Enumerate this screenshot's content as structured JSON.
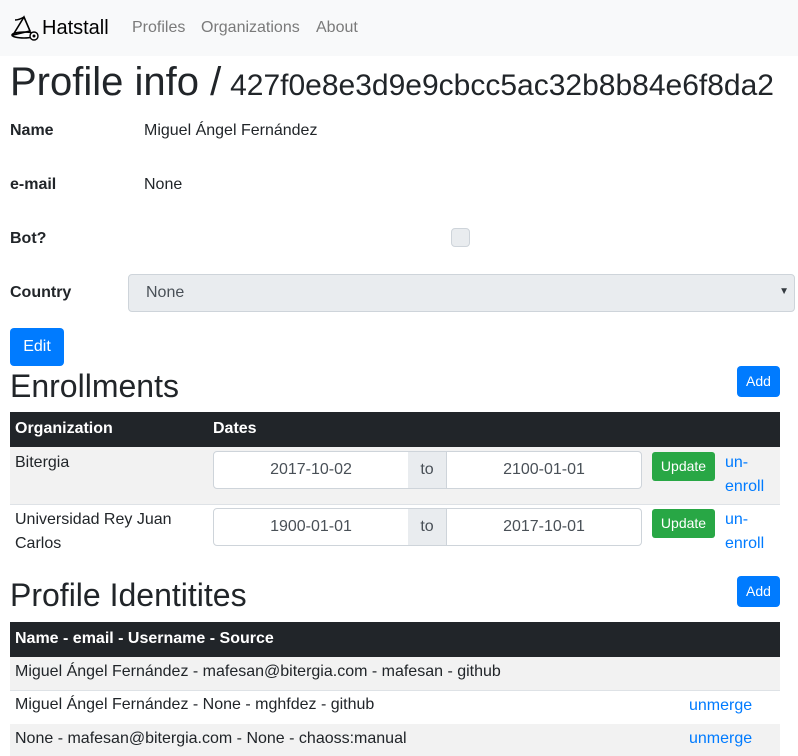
{
  "navbar": {
    "brand": "Hatstall",
    "links": [
      "Profiles",
      "Organizations",
      "About"
    ]
  },
  "page": {
    "title_prefix": "Profile info /",
    "profile_id": "427f0e8e3d9e9cbcc5ac32b8b84e6f8da2"
  },
  "profile": {
    "name_label": "Name",
    "name_value": "Miguel Ángel Fernández",
    "email_label": "e-mail",
    "email_value": "None",
    "bot_label": "Bot?",
    "country_label": "Country",
    "country_value": "None",
    "edit_label": "Edit"
  },
  "enrollments": {
    "title": "Enrollments",
    "add_label": "Add",
    "headers": [
      "Organization",
      "Dates"
    ],
    "to_label": "to",
    "update_label": "Update",
    "unenroll_label_1": "un-",
    "unenroll_label_2": "enroll",
    "rows": [
      {
        "org_line1": "Bitergia",
        "org_line2": "",
        "from": "2017-10-02",
        "to": "2100-01-01"
      },
      {
        "org_line1": "Universidad Rey Juan",
        "org_line2": "Carlos",
        "from": "1900-01-01",
        "to": "2017-10-01"
      }
    ]
  },
  "identities": {
    "title": "Profile Identitites",
    "add_label": "Add",
    "header": "Name - email - Username - Source",
    "unmerge_label": "unmerge",
    "rows": [
      {
        "text": "Miguel Ángel Fernández - mafesan@bitergia.com - mafesan - github",
        "action": ""
      },
      {
        "text": "Miguel Ángel Fernández - None - mghfdez - github",
        "action": "unmerge"
      },
      {
        "text": "None - mafesan@bitergia.com - None - chaoss:manual",
        "action": "unmerge"
      }
    ]
  },
  "colors": {
    "primary": "#007bff",
    "success": "#28a745",
    "table_header": "#212529",
    "navbar_bg": "#f8f9fa"
  },
  "icons": {
    "brand": "wizard-hat-icon",
    "select": "caret-down-icon"
  }
}
